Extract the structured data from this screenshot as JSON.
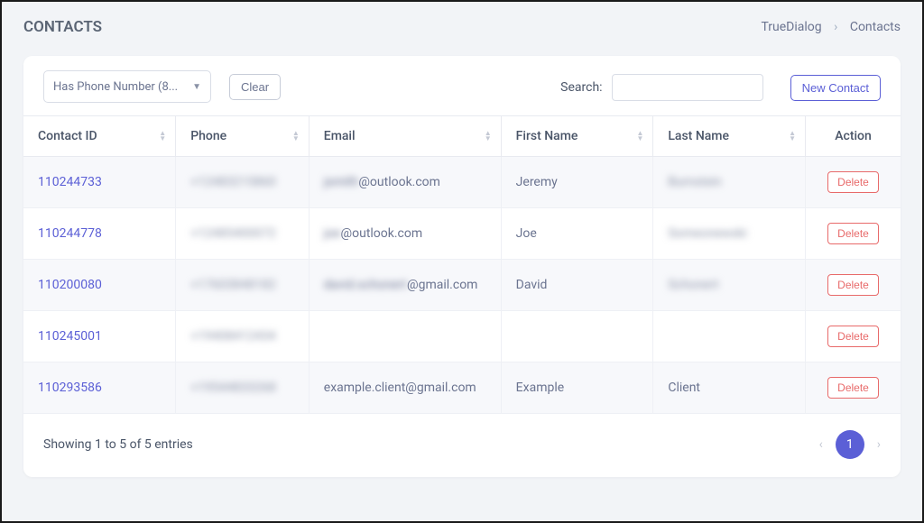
{
  "header": {
    "title": "CONTACTS",
    "breadcrumb": {
      "root": "TrueDialog",
      "separator": "›",
      "current": "Contacts"
    }
  },
  "toolbar": {
    "search_label": "Search:",
    "search_placeholder": "",
    "new_contact_label": "New Contact",
    "filter_label": "Has Phone Number (8...",
    "clear_label": "Clear"
  },
  "table": {
    "columns": {
      "contact_id": "Contact ID",
      "phone": "Phone",
      "email": "Email",
      "first_name": "First Name",
      "last_name": "Last Name",
      "action": "Action"
    },
    "action_button_label": "Delete",
    "rows": [
      {
        "id": "110244733",
        "phone": "+12483215860",
        "phone_blurred": true,
        "email_prefix_blur": "jsmith",
        "email_clear": "@outlook.com",
        "first_name": "Jeremy",
        "last_name": "Burnstein",
        "last_name_blurred": true
      },
      {
        "id": "110244778",
        "phone": "+12485400072",
        "phone_blurred": true,
        "email_prefix_blur": "joe",
        "email_clear": "@outlook.com",
        "first_name": "Joe",
        "last_name": "Someonewski",
        "last_name_blurred": true
      },
      {
        "id": "110200080",
        "phone": "+17603848182",
        "phone_blurred": true,
        "email_prefix_blur": "david.schonert",
        "email_clear": "@gmail.com",
        "first_name": "David",
        "last_name": "Schonert",
        "last_name_blurred": true
      },
      {
        "id": "110245001",
        "phone": "+19408412434",
        "phone_blurred": true,
        "email_prefix_blur": "",
        "email_clear": "",
        "first_name": "",
        "last_name": "",
        "last_name_blurred": false
      },
      {
        "id": "110293586",
        "phone": "+19544833268",
        "phone_blurred": true,
        "email_prefix_blur": "",
        "email_clear": "example.client@gmail.com",
        "first_name": "Example",
        "last_name": "Client",
        "last_name_blurred": false
      }
    ]
  },
  "footer": {
    "info": "Showing 1 to 5 of 5 entries",
    "current_page": "1"
  }
}
